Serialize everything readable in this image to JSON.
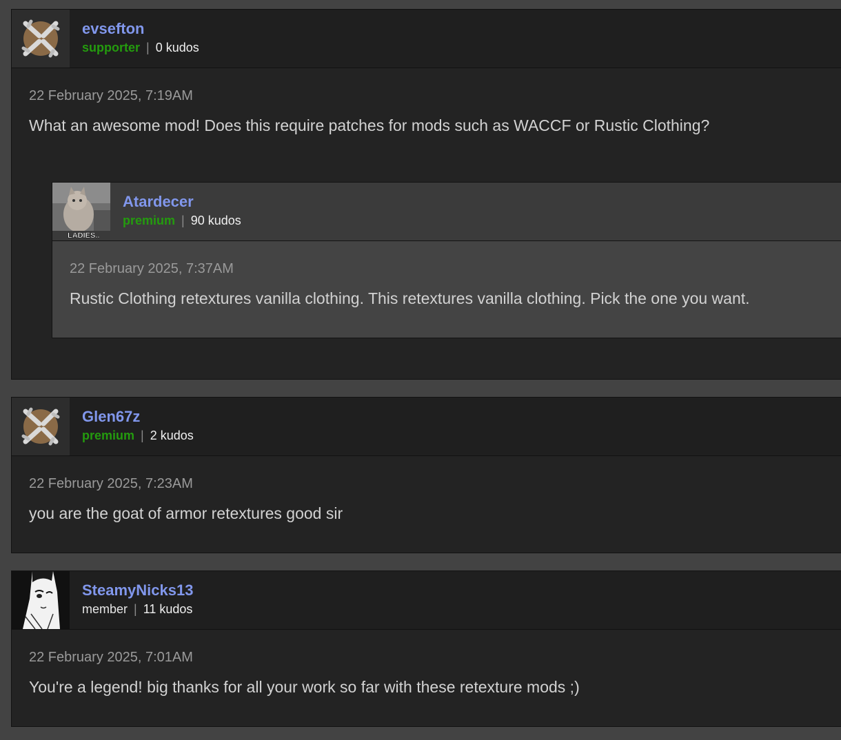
{
  "comments": [
    {
      "username": "evsefton",
      "role": "supporter",
      "kudos": "0 kudos",
      "date": "22 February 2025, 7:19AM",
      "text": "What an awesome mod! Does this require patches for mods such as WACCF or Rustic Clothing?",
      "avatar_icon": "nexus-logo-icon",
      "replies": [
        {
          "username": "Atardecer",
          "role": "premium",
          "kudos": "90 kudos",
          "date": "22 February 2025, 7:37AM",
          "text": "Rustic Clothing retextures vanilla clothing. This retextures vanilla clothing. Pick the one you want.",
          "avatar_caption": "LADIES.."
        }
      ]
    },
    {
      "username": "Glen67z",
      "role": "premium",
      "kudos": "2 kudos",
      "date": "22 February 2025, 7:23AM",
      "text": "you are the goat of armor retextures good sir",
      "avatar_icon": "nexus-logo-icon"
    },
    {
      "username": "SteamyNicks13",
      "role": "member",
      "kudos": "11 kudos",
      "date": "22 February 2025, 7:01AM",
      "text": "You're a legend! big thanks for all your work so far with these retexture mods ;)"
    }
  ],
  "separator": "|",
  "colors": {
    "username": "#8197ec",
    "premium": "#249b0e",
    "page_bg": "#434343",
    "post_bg": "#232323"
  }
}
